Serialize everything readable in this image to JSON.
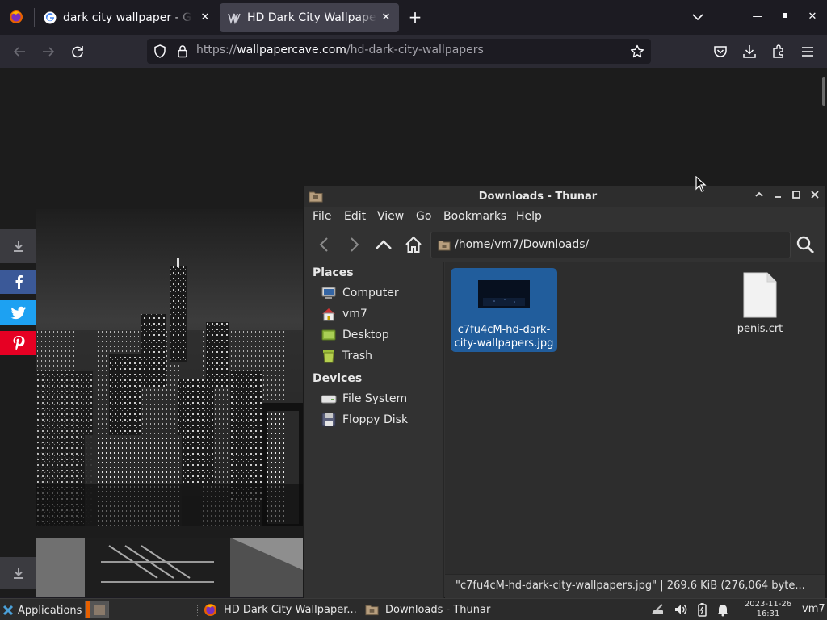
{
  "browser": {
    "tabs": [
      {
        "title": "dark city wallpaper - Google Search",
        "active": false
      },
      {
        "title": "HD Dark City Wallpapers",
        "active": true
      }
    ],
    "url_prefix": "https://",
    "url_host": "wallpapercave.com",
    "url_path": "/hd-dark-city-wallpapers"
  },
  "thunar": {
    "title": "Downloads - Thunar",
    "menu": [
      "File",
      "Edit",
      "View",
      "Go",
      "Bookmarks",
      "Help"
    ],
    "location": "/home/vm7/Downloads/",
    "sidebar": {
      "places_header": "Places",
      "places": [
        "Computer",
        "vm7",
        "Desktop",
        "Trash"
      ],
      "devices_header": "Devices",
      "devices": [
        "File System",
        "Floppy Disk"
      ]
    },
    "files": [
      {
        "name": "c7fu4cM-hd-dark-city-wallpapers.jpg",
        "selected": true
      },
      {
        "name": "penis.crt",
        "selected": false
      }
    ],
    "status": "\"c7fu4cM-hd-dark-city-wallpapers.jpg\"  |  269.6 KiB (276,064 byte..."
  },
  "taskbar": {
    "applications": "Applications",
    "tasks": [
      "HD Dark City Wallpaper...",
      "Downloads - Thunar"
    ],
    "clock_date": "2023-11-26",
    "clock_time": "16:31",
    "user": "vm7"
  },
  "colors": {
    "selection": "#215d9c",
    "facebook": "#3b5998",
    "twitter": "#1da1f2",
    "pinterest": "#e60023"
  }
}
